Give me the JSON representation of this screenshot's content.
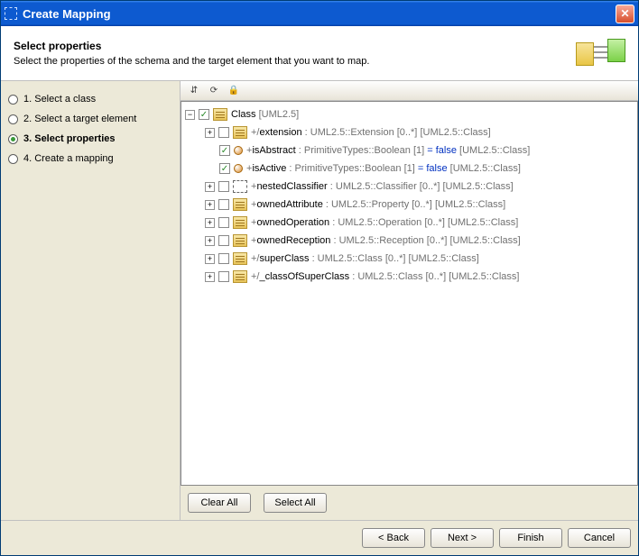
{
  "window": {
    "title": "Create Mapping"
  },
  "header": {
    "title": "Select properties",
    "subtitle": "Select the properties of the schema and the target element that you want to map."
  },
  "steps": [
    {
      "label": "1. Select a class",
      "active": false
    },
    {
      "label": "2. Select a target element",
      "active": false
    },
    {
      "label": "3. Select properties",
      "active": true
    },
    {
      "label": "4. Create a mapping",
      "active": false
    }
  ],
  "toolbar": {
    "expand_icon": "expand-toggle-icon",
    "sort_icon": "sort-icon",
    "lock_icon": "lock-icon"
  },
  "tree": {
    "root": {
      "checked": true,
      "label_main": "Class",
      "label_suffix": " [UML2.5]",
      "children": [
        {
          "checked": false,
          "icon": "class",
          "pre": "+/",
          "name": "extension ",
          "type": ": UML2.5::Extension [0..*] ",
          "suffix": "[UML2.5::Class]"
        },
        {
          "checked": true,
          "icon": "prop",
          "pre": "+",
          "name": "isAbstract ",
          "type": ": PrimitiveTypes::Boolean [1] ",
          "eq": "= false ",
          "suffix": "[UML2.5::Class]"
        },
        {
          "checked": true,
          "icon": "prop",
          "pre": "+",
          "name": "isActive ",
          "type": ": PrimitiveTypes::Boolean [1] ",
          "eq": "= false ",
          "suffix": "[UML2.5::Class]"
        },
        {
          "checked": false,
          "icon": "dashed",
          "pre": "+",
          "name": "nestedClassifier ",
          "type": ": UML2.5::Classifier [0..*] ",
          "suffix": "[UML2.5::Class]"
        },
        {
          "checked": false,
          "icon": "class",
          "pre": "+",
          "name": "ownedAttribute ",
          "type": ": UML2.5::Property [0..*] ",
          "suffix": "[UML2.5::Class]"
        },
        {
          "checked": false,
          "icon": "class",
          "pre": "+",
          "name": "ownedOperation ",
          "type": ": UML2.5::Operation [0..*] ",
          "suffix": "[UML2.5::Class]"
        },
        {
          "checked": false,
          "icon": "class",
          "pre": "+",
          "name": "ownedReception ",
          "type": ": UML2.5::Reception [0..*] ",
          "suffix": "[UML2.5::Class]"
        },
        {
          "checked": false,
          "icon": "class",
          "pre": "+/",
          "name": "superClass ",
          "type": ": UML2.5::Class [0..*] ",
          "suffix": "[UML2.5::Class]"
        },
        {
          "checked": false,
          "icon": "class",
          "pre": "+/",
          "name": "_classOfSuperClass ",
          "type": ": UML2.5::Class [0..*] ",
          "suffix": "[UML2.5::Class]"
        }
      ]
    }
  },
  "buttons": {
    "clear_all": "Clear All",
    "select_all": "Select All",
    "back": "< Back",
    "next": "Next >",
    "finish": "Finish",
    "cancel": "Cancel"
  }
}
